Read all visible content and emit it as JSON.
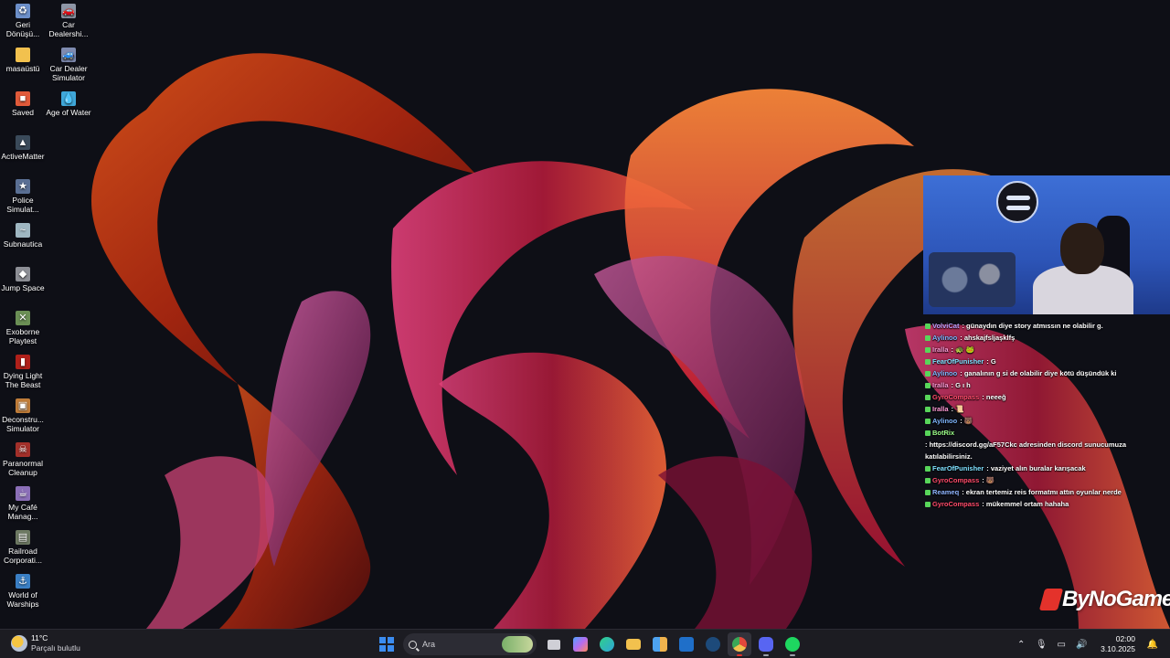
{
  "desktop": {
    "icons": [
      {
        "label": "Geri Dönüşü...",
        "icon": "recycle-bin-icon",
        "color": "#6c8fc9"
      },
      {
        "label": "Car Dealershi...",
        "icon": "car-dealership-icon",
        "color": "#8e96a6"
      },
      {
        "label": "masaüstü",
        "icon": "folder-icon",
        "color": "#f2c14e"
      },
      {
        "label": "Car Dealer Simulator",
        "icon": "car-dealer-sim-icon",
        "color": "#7f8bb0"
      },
      {
        "label": "Saved",
        "icon": "saved-icon",
        "color": "#e05a3a"
      },
      {
        "label": "Age of Water",
        "icon": "age-of-water-icon",
        "color": "#3fa7d9"
      },
      {
        "label": "ActiveMatter",
        "icon": "activematter-icon",
        "color": "#c9d3dc"
      },
      {
        "label": "Police Simulat...",
        "icon": "police-sim-icon",
        "color": "#5a6f94"
      },
      {
        "label": "Subnautica",
        "icon": "subnautica-icon",
        "color": "#9fb7c2"
      },
      {
        "label": "Jump Space",
        "icon": "jump-space-icon",
        "color": "#8d8f96"
      },
      {
        "label": "Exoborne Playtest",
        "icon": "exoborne-icon",
        "color": "#6b8f55"
      },
      {
        "label": "Dying Light The Beast",
        "icon": "dying-light-icon",
        "color": "#b0201a"
      },
      {
        "label": "Deconstru... Simulator",
        "icon": "deconstruction-sim-icon",
        "color": "#c07d3a"
      },
      {
        "label": "Paranormal Cleanup",
        "icon": "paranormal-icon",
        "color": "#a3302a"
      },
      {
        "label": "My Café Manag...",
        "icon": "my-cafe-icon",
        "color": "#8b6fb8"
      },
      {
        "label": "Railroad Corporati...",
        "icon": "railroad-icon",
        "color": "#6e7a63"
      },
      {
        "label": "World of Warships",
        "icon": "world-of-warships-icon",
        "color": "#3a7fc4"
      }
    ]
  },
  "chat": {
    "messages": [
      {
        "user": "VolviCat",
        "color": "#b9a3ff",
        "text": ": günaydın diye story atmıssın ne olabilir g."
      },
      {
        "user": "Aylinoo",
        "color": "#7fb6ff",
        "text": ": ahskajfsljaşklfş"
      },
      {
        "user": "Iralla",
        "color": "#ff9ad6",
        "text": ": 🐢 🐸"
      },
      {
        "user": "FearOfPunisher",
        "color": "#7fe0ff",
        "text": ": G"
      },
      {
        "user": "Aylinoo",
        "color": "#7fb6ff",
        "text": ": ganalının g si de olabilir diye kötü düşündük ki"
      },
      {
        "user": "Iralla",
        "color": "#ff9ad6",
        "text": ": G ı h"
      },
      {
        "user": "GyroCompass",
        "color": "#ff4b6b",
        "text": ": neeeğ"
      },
      {
        "user": "Iralla",
        "color": "#ff9ad6",
        "text": ": 📜"
      },
      {
        "user": "Aylinoo",
        "color": "#7fb6ff",
        "text": ": 🐻"
      },
      {
        "user": "BotRix",
        "color": "#9cff8a",
        "text": ": https://discord.gg/aF57Ckc adresinden discord sunucumuza katılabilirsiniz."
      },
      {
        "user": "FearOfPunisher",
        "color": "#7fe0ff",
        "text": ": vaziyet alın buralar karışacak"
      },
      {
        "user": "GyroCompass",
        "color": "#ff4b6b",
        "text": ": 🐻"
      },
      {
        "user": "Reameq",
        "color": "#8fb4ff",
        "text": ": ekran tertemiz reis formatmı attın oyunlar nerde"
      },
      {
        "user": "GyroCompass",
        "color": "#ff4b6b",
        "text": ": mükemmel ortam hahaha"
      }
    ]
  },
  "brand": {
    "text": "ByNoGame",
    "color": "#e4322b"
  },
  "taskbar": {
    "weather": {
      "temp": "11°C",
      "condition": "Parçalı bulutlu"
    },
    "search_placeholder": "Ara",
    "apps": [
      {
        "name": "start-button",
        "color": "#3b8cf0"
      },
      {
        "name": "task-view-button",
        "color": "#cfcfd6"
      },
      {
        "name": "copilot-app",
        "color": "#b56cf0"
      },
      {
        "name": "edge-app",
        "color": "#2fa6d8"
      },
      {
        "name": "file-explorer-app",
        "color": "#f2c14e"
      },
      {
        "name": "store-app",
        "color": "#4da3f0"
      },
      {
        "name": "outlook-app",
        "color": "#1f6fc9"
      },
      {
        "name": "steam-app",
        "color": "#1d4a7a"
      },
      {
        "name": "chrome-app",
        "color": "#e8b33a"
      },
      {
        "name": "discord-app",
        "color": "#5865f2"
      },
      {
        "name": "spotify-app",
        "color": "#1ed760"
      }
    ],
    "clock": {
      "time": "02:00",
      "date": "3.10.2025"
    }
  }
}
